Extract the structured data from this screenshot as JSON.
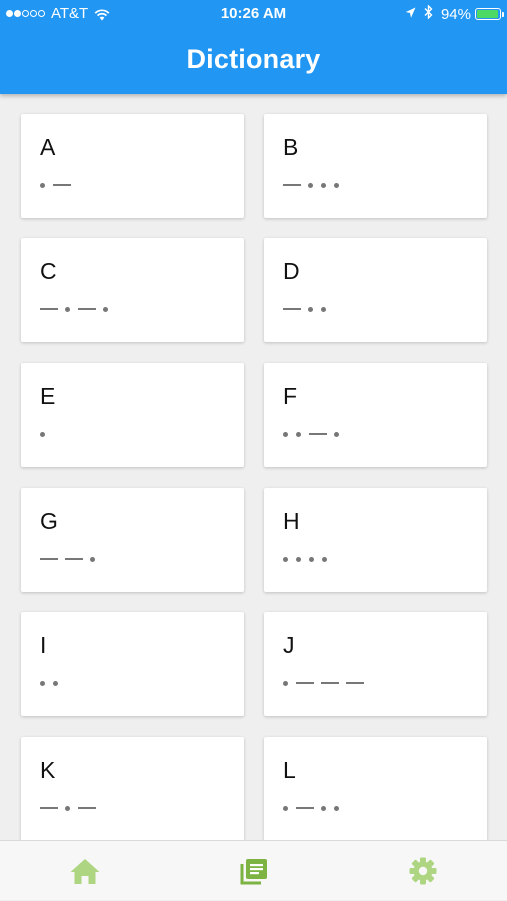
{
  "status_bar": {
    "signal_bars": [
      true,
      true,
      false,
      false,
      false
    ],
    "carrier": "AT&T",
    "time": "10:26 AM",
    "battery_percent": "94%",
    "battery_level": 0.94,
    "icons": [
      "wifi-icon",
      "location-arrow-icon",
      "bluetooth-icon",
      "battery-icon"
    ]
  },
  "header": {
    "title": "Dictionary",
    "color": "#2196f3"
  },
  "entries": [
    {
      "letter": "A",
      "code": ".-"
    },
    {
      "letter": "B",
      "code": "-..."
    },
    {
      "letter": "C",
      "code": "-.-."
    },
    {
      "letter": "D",
      "code": "-.."
    },
    {
      "letter": "E",
      "code": "."
    },
    {
      "letter": "F",
      "code": "..-."
    },
    {
      "letter": "G",
      "code": "--."
    },
    {
      "letter": "H",
      "code": "...."
    },
    {
      "letter": "I",
      "code": ".."
    },
    {
      "letter": "J",
      "code": ".---"
    },
    {
      "letter": "K",
      "code": "-.-"
    },
    {
      "letter": "L",
      "code": ".-.."
    }
  ],
  "tabbar": {
    "tabs": [
      {
        "name": "home",
        "icon": "home-icon",
        "active": false
      },
      {
        "name": "dictionary",
        "icon": "dictionary-icon",
        "active": true
      },
      {
        "name": "settings",
        "icon": "gear-icon",
        "active": false
      }
    ],
    "inactive_color": "#aed581",
    "active_color": "#7cb342"
  }
}
